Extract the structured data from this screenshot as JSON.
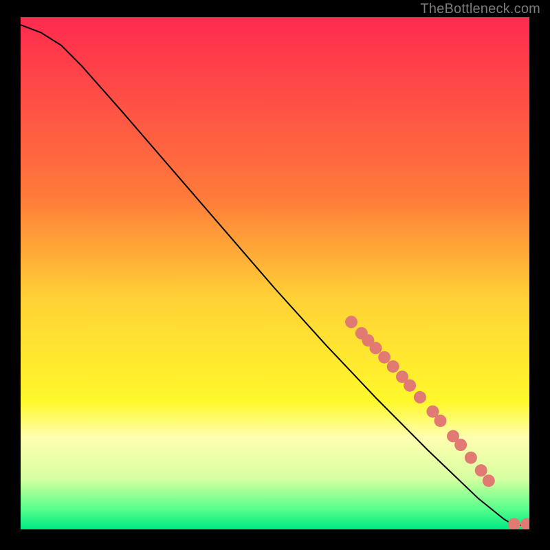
{
  "attribution": "TheBottleneck.com",
  "chart_data": {
    "type": "line",
    "title": "",
    "xlabel": "",
    "ylabel": "",
    "xlim": [
      0,
      100
    ],
    "ylim": [
      0,
      100
    ],
    "background_gradient": {
      "stops": [
        {
          "offset": 0,
          "color": "#ff2a4f"
        },
        {
          "offset": 35,
          "color": "#ff7a3a"
        },
        {
          "offset": 55,
          "color": "#ffd236"
        },
        {
          "offset": 75,
          "color": "#fff82a"
        },
        {
          "offset": 82,
          "color": "#ffffb0"
        },
        {
          "offset": 90,
          "color": "#d8ffa0"
        },
        {
          "offset": 96,
          "color": "#58ff8c"
        },
        {
          "offset": 100,
          "color": "#00e983"
        }
      ]
    },
    "series": [
      {
        "name": "bottleneck-curve",
        "color": "#000000",
        "curve": [
          {
            "x": 0,
            "y": 98.5
          },
          {
            "x": 4,
            "y": 97.0
          },
          {
            "x": 8,
            "y": 94.5
          },
          {
            "x": 12,
            "y": 90.5
          },
          {
            "x": 20,
            "y": 81.5
          },
          {
            "x": 30,
            "y": 70.0
          },
          {
            "x": 40,
            "y": 58.5
          },
          {
            "x": 50,
            "y": 47.0
          },
          {
            "x": 60,
            "y": 36.0
          },
          {
            "x": 70,
            "y": 25.5
          },
          {
            "x": 80,
            "y": 15.5
          },
          {
            "x": 90,
            "y": 6.0
          },
          {
            "x": 95,
            "y": 2.0
          },
          {
            "x": 97,
            "y": 0.8
          },
          {
            "x": 100,
            "y": 0.8
          }
        ],
        "markers": [
          {
            "x": 65.0,
            "y": 40.5
          },
          {
            "x": 67.0,
            "y": 38.3
          },
          {
            "x": 68.3,
            "y": 36.9
          },
          {
            "x": 69.8,
            "y": 35.4
          },
          {
            "x": 71.5,
            "y": 33.6
          },
          {
            "x": 73.2,
            "y": 31.8
          },
          {
            "x": 75.0,
            "y": 29.8
          },
          {
            "x": 76.5,
            "y": 28.1
          },
          {
            "x": 78.5,
            "y": 25.8
          },
          {
            "x": 81.0,
            "y": 23.0
          },
          {
            "x": 82.5,
            "y": 21.2
          },
          {
            "x": 85.0,
            "y": 18.2
          },
          {
            "x": 86.5,
            "y": 16.5
          },
          {
            "x": 88.5,
            "y": 14.0
          },
          {
            "x": 90.5,
            "y": 11.5
          },
          {
            "x": 92.0,
            "y": 9.5
          },
          {
            "x": 97.0,
            "y": 1.0
          },
          {
            "x": 99.5,
            "y": 1.0
          },
          {
            "x": 100.5,
            "y": 1.0
          }
        ],
        "marker_color": "#e07a72",
        "marker_radius": 9
      }
    ]
  }
}
